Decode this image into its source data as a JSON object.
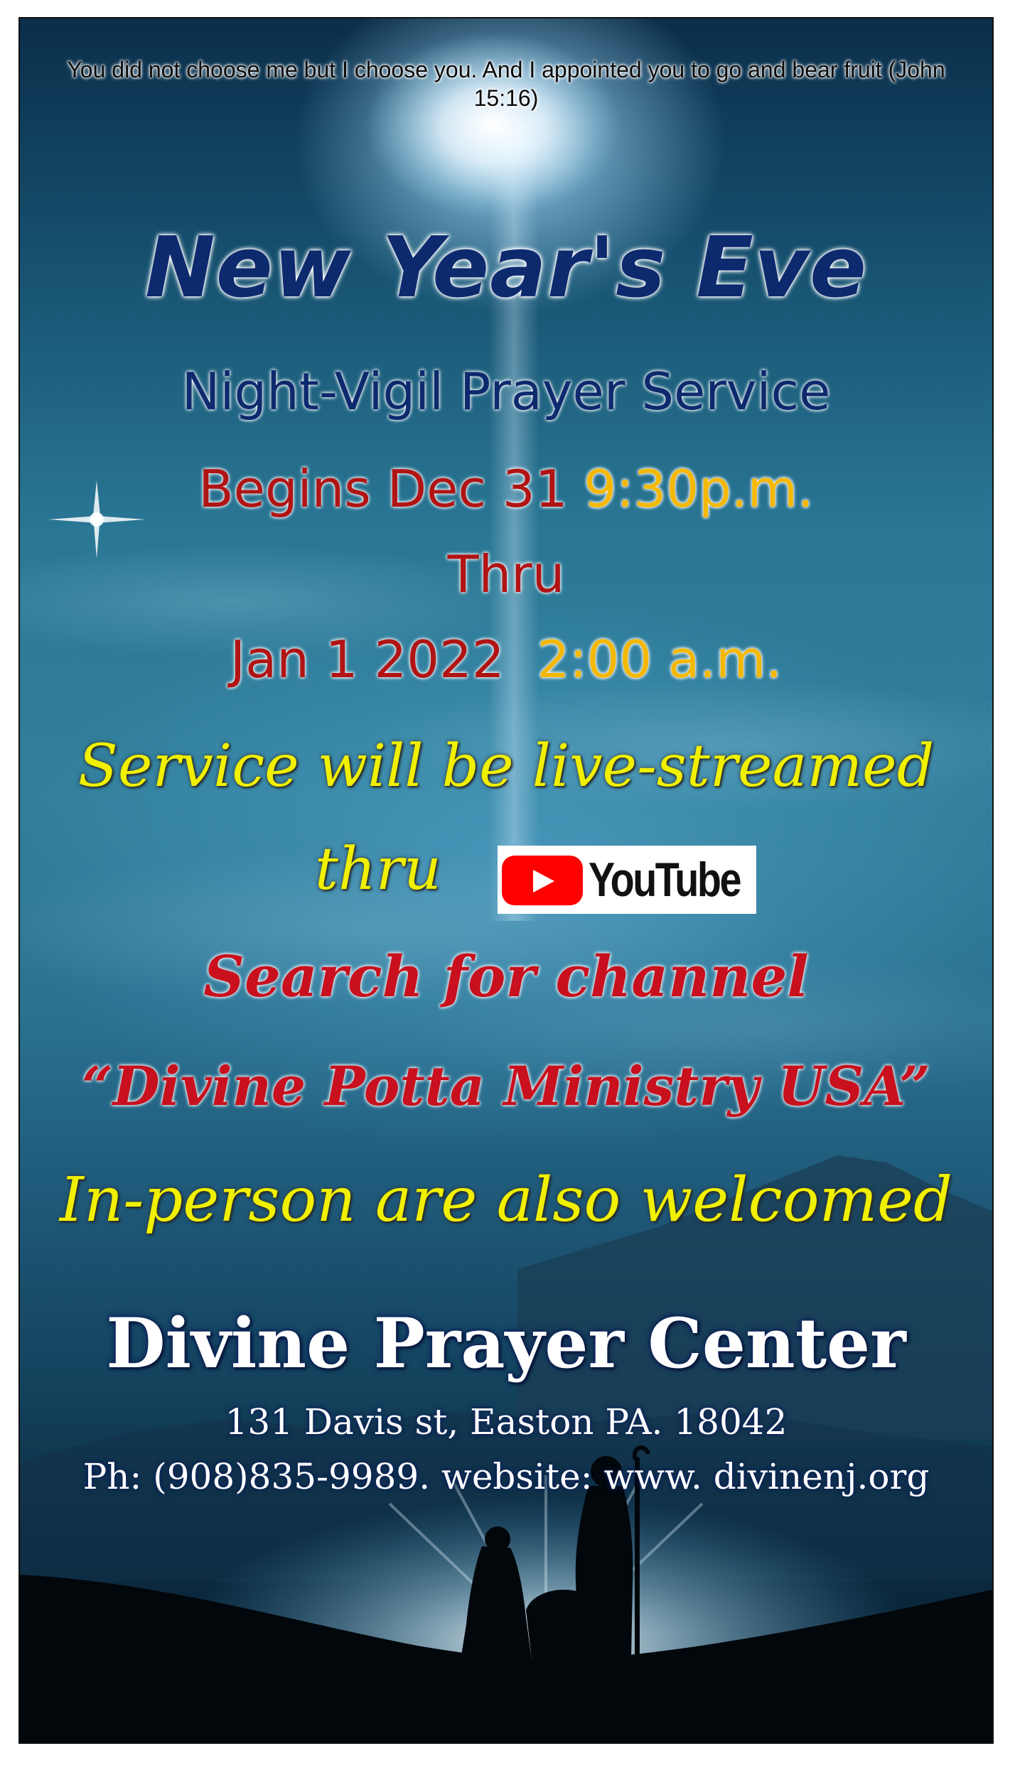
{
  "scripture": "You did not choose me but I choose you. And I appointed you to go and bear fruit (John 15:16)",
  "title": "New Year's Eve",
  "subtitle": "Night-Vigil Prayer Service",
  "schedule": {
    "begins_label": "Begins Dec 31",
    "begins_time": "9:30p.m.",
    "thru": "Thru",
    "end_date": "Jan 1 2022",
    "end_time": "2:00 a.m."
  },
  "stream": {
    "line1": "Service will be live-streamed",
    "thru_word": "thru",
    "platform": "YouTube"
  },
  "search": {
    "line1": "Search for channel",
    "channel": "“Divine Potta Ministry USA”"
  },
  "in_person": "In-person are also  welcomed",
  "center": {
    "name": "Divine Prayer Center",
    "address": "131 Davis st, Easton PA. 18042",
    "contact": "Ph: (908)835-9989. website: www. divinenj.org"
  },
  "colors": {
    "title_navy": "#0e2a6e",
    "date_red": "#b11414",
    "time_gold": "#f5b800",
    "script_yellow": "#f0f000",
    "script_red": "#c8101e",
    "youtube_red": "#ff0000"
  },
  "icons": [
    "youtube-logo-icon",
    "star-icon"
  ]
}
